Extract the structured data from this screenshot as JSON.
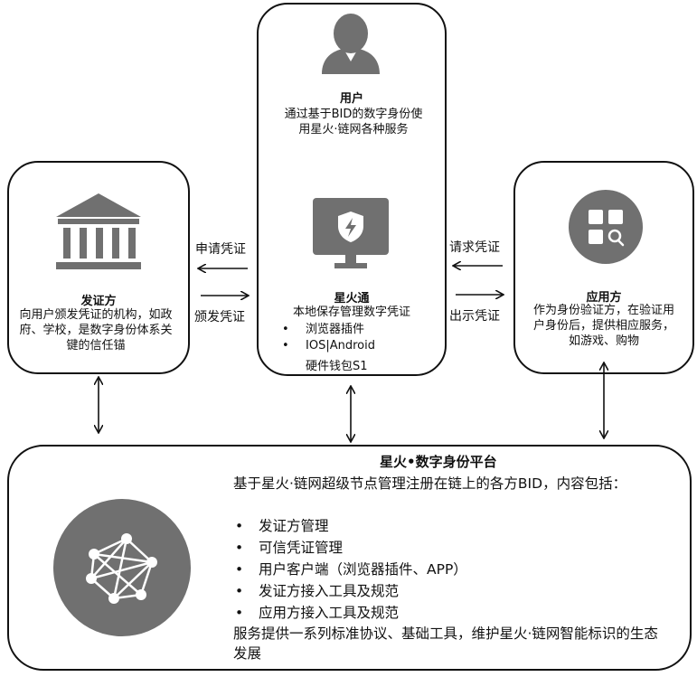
{
  "issuer": {
    "title": "发证方",
    "desc": "向用户颁发凭证的机构，如政府、学校，是数字身份体系关键的信任锚",
    "icon": "bank-building-icon"
  },
  "user": {
    "title": "用户",
    "desc": "通过基于BID的数字身份使用星火·链网各种服务",
    "icon": "user-silhouette-icon"
  },
  "wallet": {
    "title": "星火通",
    "desc": "本地保存管理数字凭证",
    "items": [
      "浏览器插件",
      "IOS|Android"
    ],
    "extra": "硬件钱包S1",
    "icon": "monitor-shield-icon"
  },
  "app": {
    "title": "应用方",
    "desc": "作为身份验证方，在验证用户身份后，提供相应服务，如游戏、购物",
    "icon": "apps-search-icon"
  },
  "arrows": {
    "apply": "申请凭证",
    "issue": "颁发凭证",
    "request": "请求凭证",
    "present": "出示凭证"
  },
  "platform": {
    "title": "星火•数字身份平台",
    "intro": "基于星火·链网超级节点管理注册在链上的各方BID，内容包括：",
    "items": [
      "发证方管理",
      "可信凭证管理",
      "用户客户端（浏览器插件、APP）",
      "发证方接入工具及规范",
      "应用方接入工具及规范"
    ],
    "outro": "服务提供一系列标准协议、基础工具，维护星火·链网智能标识的生态发展",
    "icon": "network-nodes-icon"
  },
  "colors": {
    "icon_gray": "#707070",
    "line": "#111111"
  }
}
